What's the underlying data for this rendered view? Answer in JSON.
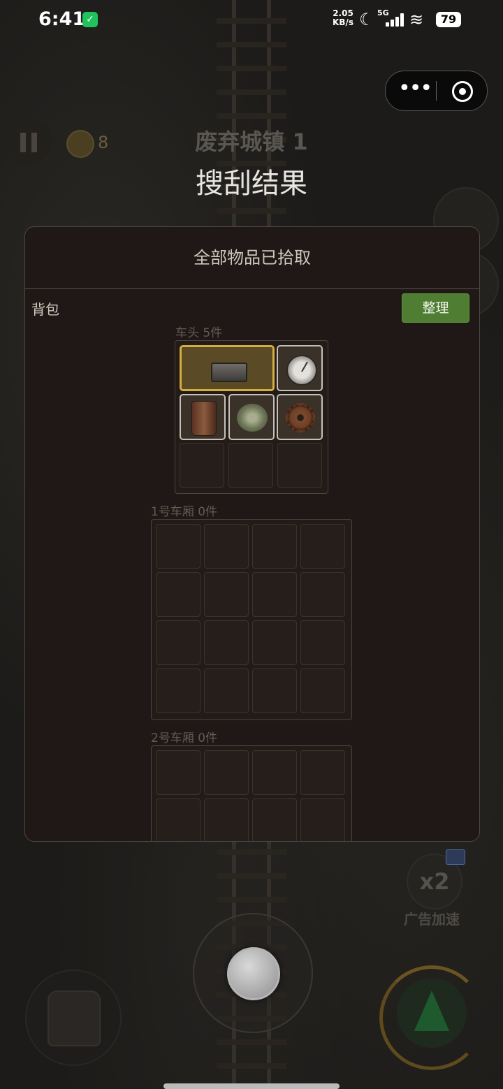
{
  "status_bar": {
    "time": "6:41",
    "net_speed_value": "2.05",
    "net_speed_unit": "KB/s",
    "signal": "5G",
    "battery": "79"
  },
  "hud": {
    "coin_count": "8",
    "level_title": "废弃城镇 1",
    "result_title": "搜刮结果"
  },
  "panel": {
    "header": "全部物品已拾取",
    "bag_label": "背包",
    "sort_button": "整理",
    "sections": [
      {
        "label": "车头 5件"
      },
      {
        "label": "1号车厢 0件"
      },
      {
        "label": "2号车厢 0件"
      }
    ],
    "head_items": [
      "metal-plate-icon",
      "gauge-icon",
      "rusty-can-icon",
      "cabbage-icon",
      "gear-icon"
    ]
  },
  "bottom_hud": {
    "x2_label": "x2",
    "ad_speed_label": "广告加速"
  },
  "colors": {
    "accent_green": "#4f7e33",
    "selected_gold": "#d5ad3c",
    "panel_bg": "#1f1816"
  }
}
